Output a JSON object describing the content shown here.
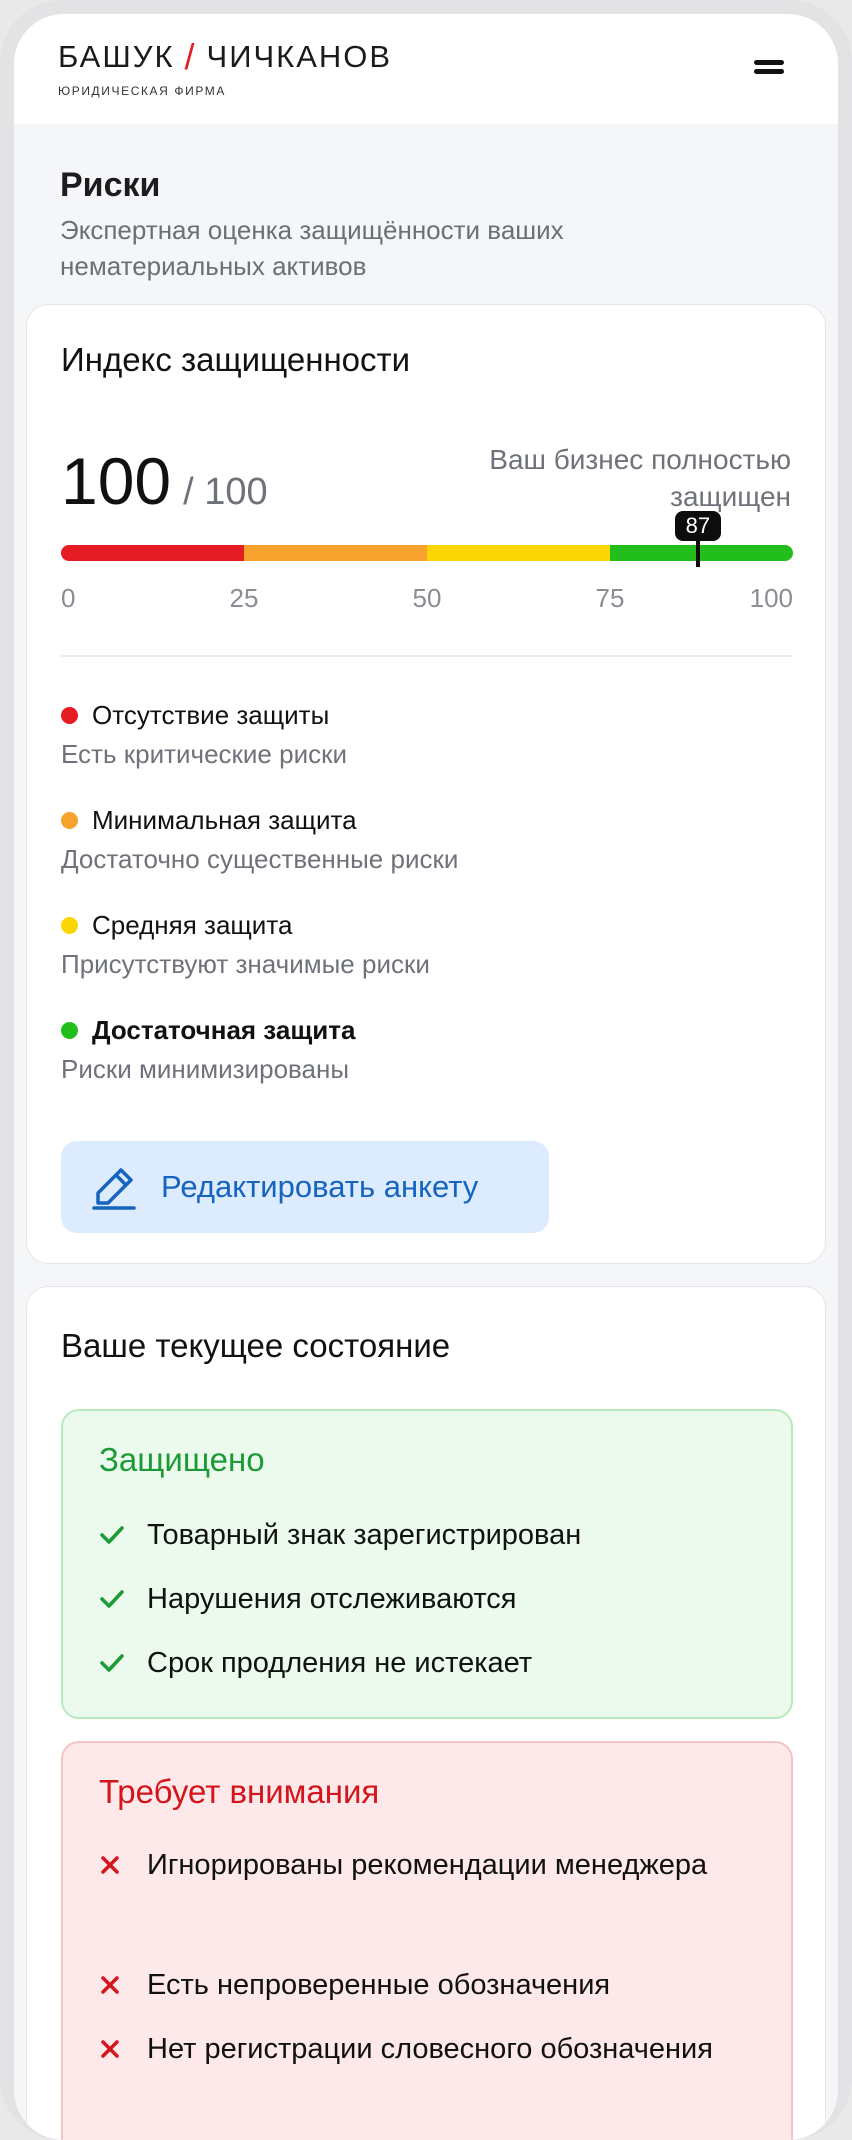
{
  "header": {
    "logo_left": "БАШУК",
    "logo_slash": "/",
    "logo_right": "ЧИЧКАНОВ",
    "logo_sub": "ЮРИДИЧЕСКАЯ ФИРМА"
  },
  "page": {
    "title": "Риски",
    "subtitle": "Экспертная оценка защищённости ваших нематериальных активов"
  },
  "index_card": {
    "title": "Индекс защищенности",
    "score": "100",
    "score_max": "/ 100",
    "caption": "Ваш бизнес полностью защищен",
    "marker_label": "87",
    "marker_value": 87,
    "ticks": [
      "0",
      "25",
      "50",
      "75",
      "100"
    ],
    "segment_colors": [
      "#e51c23",
      "#f7a22c",
      "#fbd604",
      "#22bf1c"
    ],
    "legend": [
      {
        "label": "Отсутствие защиты",
        "desc": "Есть критические риски",
        "color": "#e51c23"
      },
      {
        "label": "Минимальная защита",
        "desc": "Достаточно существенные риски",
        "color": "#f7a22c"
      },
      {
        "label": "Средняя защита",
        "desc": "Присутствуют значимые риски",
        "color": "#fbd604"
      },
      {
        "label": "Достаточная защита",
        "desc": "Риски минимизированы",
        "color": "#22bf1c"
      }
    ],
    "edit_button": "Редактировать анкету",
    "edit_icon": "pencil-icon"
  },
  "state_card": {
    "title": "Ваше текущее состояние",
    "protected": {
      "title": "Защищено",
      "items": [
        "Товарный знак зарегистрирован",
        "Нарушения отслеживаются",
        "Срок продления не истекает"
      ]
    },
    "attention": {
      "title": "Требует внимания",
      "items": [
        "Игнорированы рекомендации менеджера",
        "Есть непроверенные обозначения",
        "Нет регистрации словесного обозначения"
      ]
    }
  }
}
